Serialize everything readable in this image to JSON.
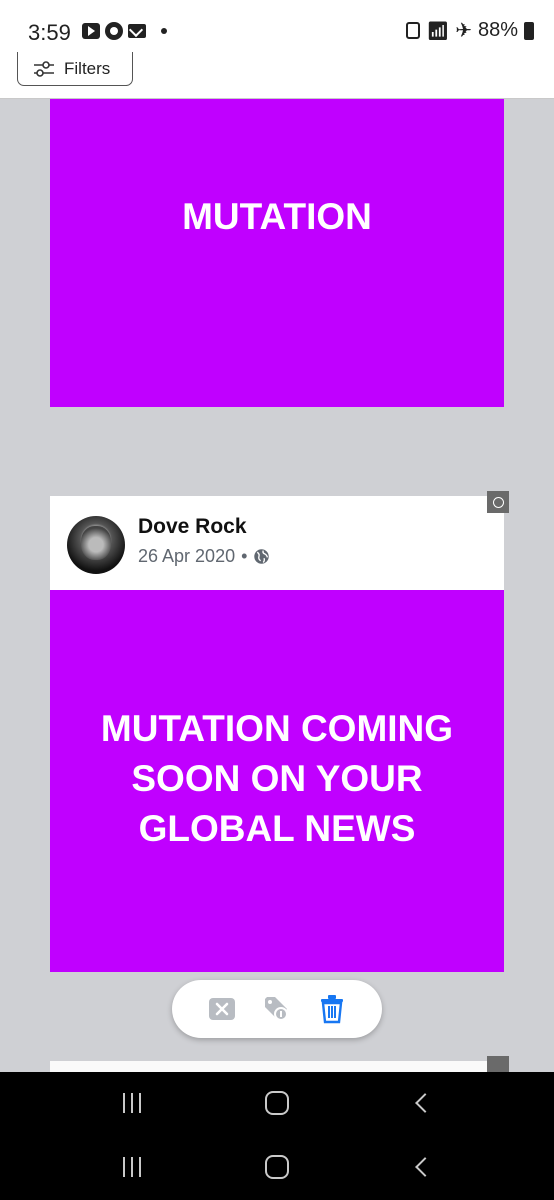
{
  "status_bar": {
    "time": "3:59",
    "battery": "88%",
    "icons_left": [
      "youtube-icon",
      "chrome-icon",
      "mail-icon",
      "dot"
    ],
    "icons_right": [
      "lock-icon",
      "wifi-icon",
      "airplane-icon",
      "battery-icon"
    ]
  },
  "filters": {
    "label": "Filters",
    "icon": "sliders-icon"
  },
  "posts": [
    {
      "image_text": "MUTATION",
      "background": "#c000ff"
    },
    {
      "author": "Dove Rock",
      "date": "26 Apr 2020",
      "separator": "•",
      "privacy_icon": "globe-icon",
      "image_text": "MUTATION COMING SOON ON YOUR GLOBAL NEWS",
      "background": "#c000ff"
    }
  ],
  "actions": [
    "close-icon",
    "tag-icon",
    "trash-icon"
  ],
  "colors": {
    "accent_blue": "#1877f2",
    "purple": "#c000ff",
    "page_bg": "#cfd0d4"
  },
  "nav": [
    "recents-icon",
    "home-icon",
    "back-icon"
  ]
}
